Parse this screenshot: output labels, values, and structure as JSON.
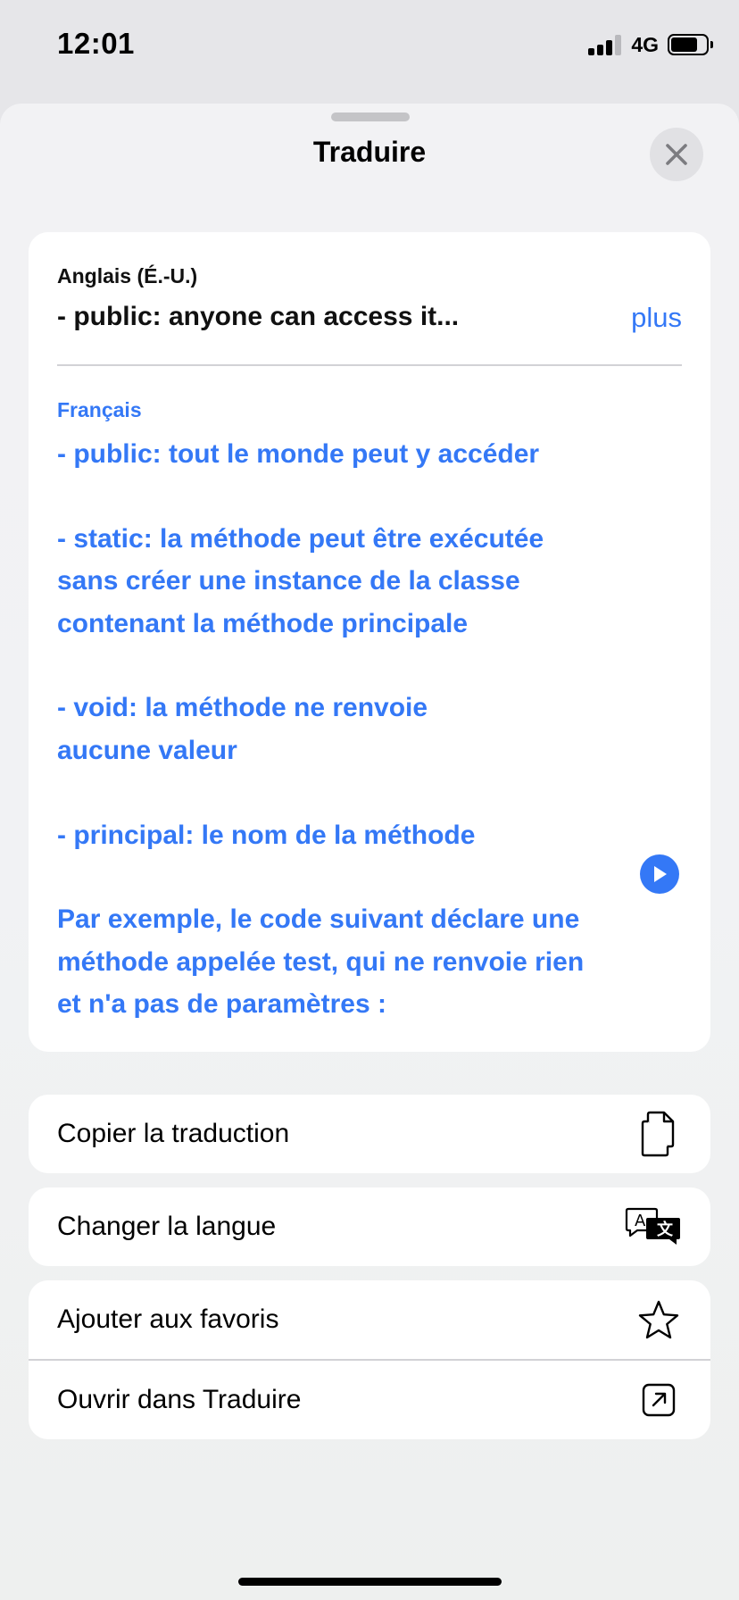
{
  "status_bar": {
    "time": "12:01",
    "network": "4G",
    "battery_level_fraction": 0.75,
    "signal_bars_filled": 3,
    "signal_bars_total": 4
  },
  "sheet": {
    "title": "Traduire",
    "close_icon": "xmark-icon"
  },
  "translation": {
    "source_language": "Anglais (É.-U.)",
    "source_text": "- public: anyone can access it...",
    "more_label": "plus",
    "target_language": "Français",
    "target_paragraphs": [
      [
        "- public: tout le monde peut y accéder"
      ],
      [
        "- static: la méthode peut être exécutée",
        "sans créer une instance de la classe",
        "contenant la méthode principale"
      ],
      [
        "- void: la méthode ne renvoie",
        "aucune valeur"
      ],
      [
        "- principal: le nom de la méthode"
      ],
      [
        "Par exemple, le code suivant déclare une",
        "méthode appelée test, qui ne renvoie rien",
        "et n'a pas de paramètres :"
      ]
    ],
    "play_icon": "play-icon",
    "accent_color": "#3478f6"
  },
  "actions": {
    "copy": {
      "label": "Copier la traduction",
      "icon": "copy-icon"
    },
    "change_language": {
      "label": "Changer la langue",
      "icon": "translate-icon"
    },
    "favorite": {
      "label": "Ajouter aux favoris",
      "icon": "star-icon"
    },
    "open_in_app": {
      "label": "Ouvrir dans Traduire",
      "icon": "open-external-icon"
    }
  }
}
